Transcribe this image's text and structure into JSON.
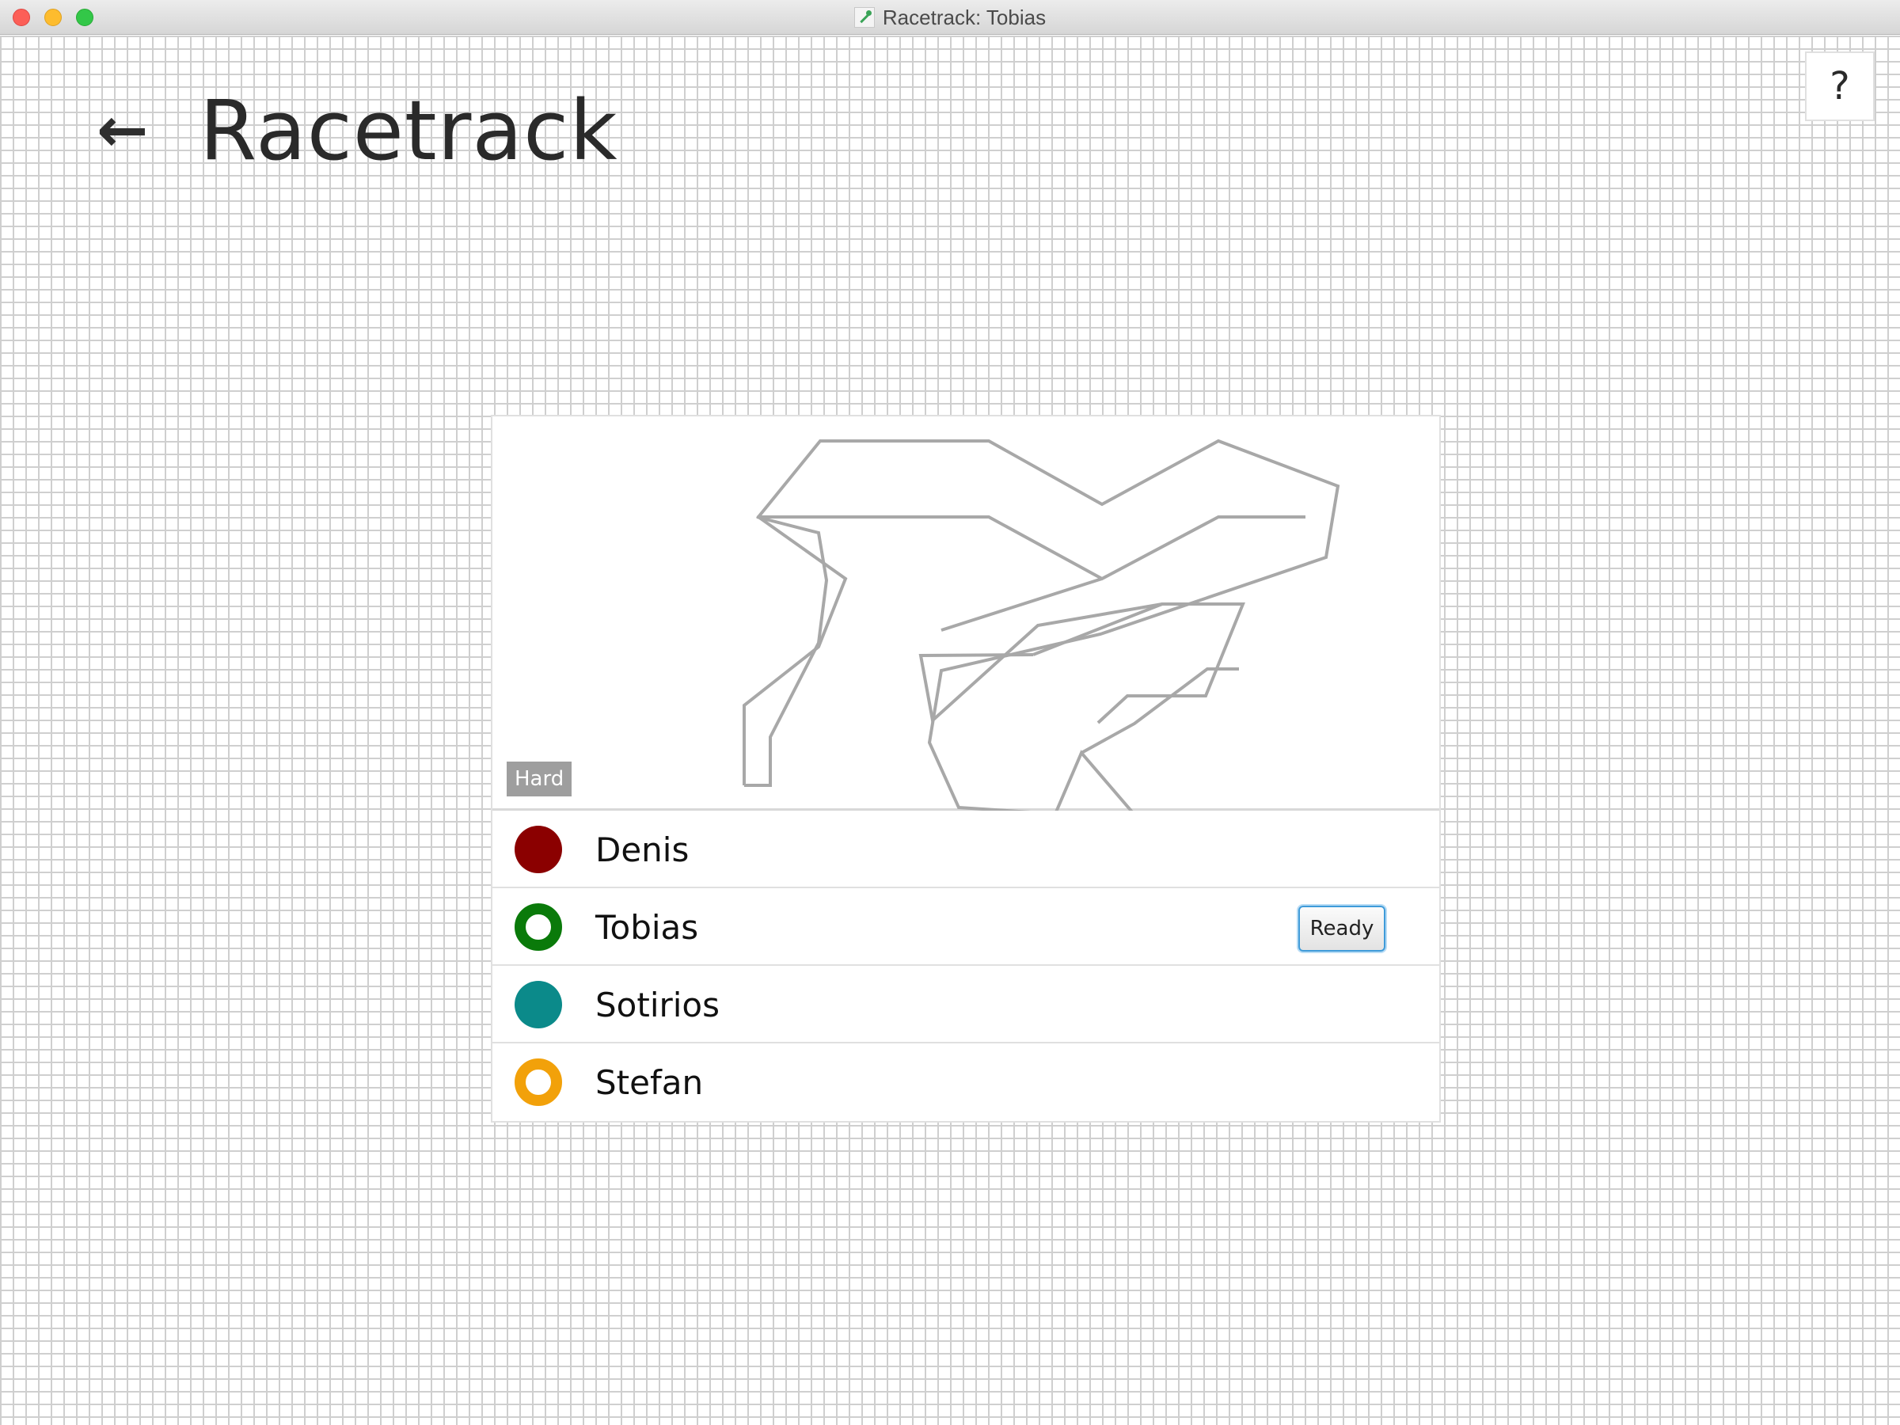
{
  "window": {
    "title": "Racetrack: Tobias"
  },
  "header": {
    "back_label": "←",
    "title": "Racetrack"
  },
  "help": {
    "label": "?"
  },
  "track": {
    "difficulty": "Hard"
  },
  "players": [
    {
      "name": "Denis",
      "color": "#8b0000",
      "marker": "filled"
    },
    {
      "name": "Tobias",
      "color": "#0a7a0a",
      "marker": "ring",
      "action_label": "Ready"
    },
    {
      "name": "Sotirios",
      "color": "#0b8a8a",
      "marker": "filled"
    },
    {
      "name": "Stefan",
      "color": "#f2a10a",
      "marker": "ring"
    }
  ]
}
